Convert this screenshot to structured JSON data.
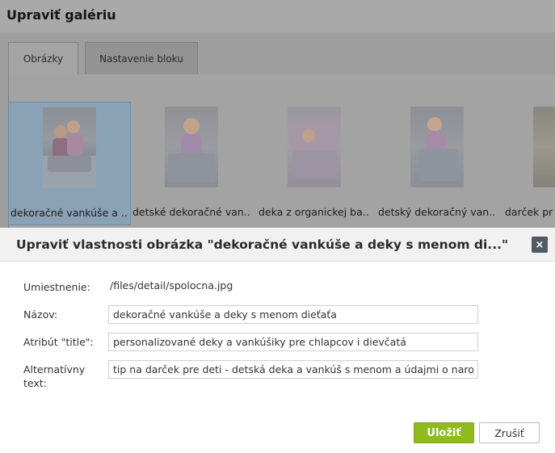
{
  "page": {
    "title": "Upraviť galériu"
  },
  "tabs": [
    {
      "label": "Obrázky",
      "active": true
    },
    {
      "label": "Nastavenie bloku",
      "active": false
    }
  ],
  "gallery": {
    "items": [
      {
        "label": "dekoračné vankúše a ..",
        "selected": true
      },
      {
        "label": "detské dekoračné van..",
        "selected": false
      },
      {
        "label": "deka z organickej ba..",
        "selected": false
      },
      {
        "label": "detský dekoračný van..",
        "selected": false
      },
      {
        "label": "darček pr",
        "selected": false
      }
    ]
  },
  "modal": {
    "title": "Upraviť vlastnosti obrázka \"dekoračné vankúše a deky s menom di...\"",
    "close_label": "×",
    "location_label": "Umiestnenie:",
    "location_value": "/files/detail/spolocna.jpg",
    "name_label": "Názov:",
    "name_value": "dekoračné vankúše a deky s menom dieťaťa",
    "title_attr_label": "Atribút \"title\":",
    "title_attr_value": "personalizované deky a vankúšiky pre chlapcov i dievčatá",
    "alt_label_line1": "Alternatívny",
    "alt_label_line2": "text:",
    "alt_value": "tip na darček pre deti - detská deka a vankúš s menom a údajmi o narodení",
    "save_label": "Uložiť",
    "cancel_label": "Zrušiť"
  },
  "colors": {
    "overlay": "#9e9e9e",
    "save_button": "#8fbb1f",
    "close_button": "#505a63",
    "selected_thumb": "#8aa2b6"
  }
}
